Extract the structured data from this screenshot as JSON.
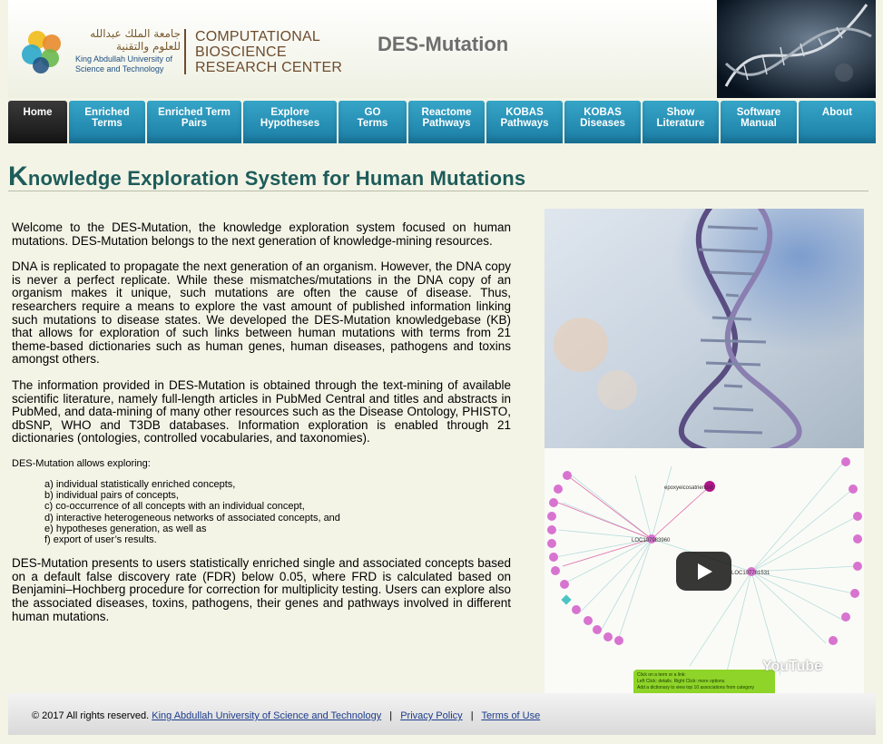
{
  "header": {
    "arabic_name": "جامعة الملك عبدالله للعلوم والتقنية",
    "university_name": "King Abdullah University of Science and Technology",
    "center_name": "Computational Bioscience Research Center",
    "app_title": "DES-Mutation"
  },
  "nav": {
    "items": [
      {
        "label": "Home",
        "active": true
      },
      {
        "label": "Enriched\nTerms"
      },
      {
        "label": "Enriched Term\nPairs"
      },
      {
        "label": "Explore\nHypotheses"
      },
      {
        "label": "GO\nTerms"
      },
      {
        "label": "Reactome\nPathways"
      },
      {
        "label": "KOBAS\nPathways"
      },
      {
        "label": "KOBAS\nDiseases"
      },
      {
        "label": "Show\nLiterature"
      },
      {
        "label": "Software\nManual"
      },
      {
        "label": "About"
      }
    ]
  },
  "page": {
    "heading_first_letter": "K",
    "heading_rest": "nowledge Exploration System for Human Mutations"
  },
  "content": {
    "intro": "Welcome to the DES-Mutation, the knowledge exploration system focused on human mutations. DES-Mutation belongs to the next generation of knowledge-mining resources.",
    "dna_paragraph": "DNA is replicated to propagate the next generation of an organism. However, the DNA copy is never a perfect replicate. While these mismatches/mutations in the DNA copy of an organism makes it unique, such mutations are often the cause of disease. Thus, researchers require a means to explore the vast amount of published information linking such mutations to disease states. We developed the DES-Mutation knowledgebase (KB) that allows for exploration of such links between human mutations with terms from 21 theme-based dictionaries such as human genes, human diseases, pathogens and toxins amongst others.",
    "info_paragraph": "The information provided in DES-Mutation is obtained through the text-mining of available scientific literature, namely full-length articles in PubMed Central and titles and abstracts in PubMed, and data-mining of many other resources such as the Disease Ontology, PHISTO, dbSNP, WHO and T3DB databases. Information exploration is enabled through 21 dictionaries (ontologies, controlled vocabularies, and taxonomies).",
    "explore_intro": "DES-Mutation allows exploring:",
    "explore_items": [
      "a) individual statistically enriched concepts,",
      "b) individual pairs of concepts,",
      "c) co-occurrence of all concepts with an individual concept,",
      "d) interactive heterogeneous networks of associated concepts, and",
      "e) hypotheses generation, as well as",
      "f) export of user’s results."
    ],
    "fdr_paragraph": "DES-Mutation presents to users statistically enriched single and associated concepts based on a default false discovery rate (FDR) below 0.05, where FRD is calculated based on Benjamini–Hochberg procedure for correction for multiplicity testing. Users can explore also the associated diseases, toxins, pathogens, their genes and pathways involved in different human mutations."
  },
  "video": {
    "brand": "YouTube",
    "hint_line1": "Click on a term or a link:",
    "hint_line2": "Left Click: details. Right Click: more options.",
    "hint_line3": "Add a dictionary to view top 10 associations from category",
    "node_a": "LOC107983960",
    "node_b": "LOC107781531",
    "node_c": "epoxyeicosatrienoid"
  },
  "footer": {
    "copyright": "© 2017 All rights reserved.",
    "kaust_link": "King Abdullah University of Science and Technology",
    "privacy_link": "Privacy Policy",
    "terms_link": "Terms of Use",
    "separator": "|"
  }
}
